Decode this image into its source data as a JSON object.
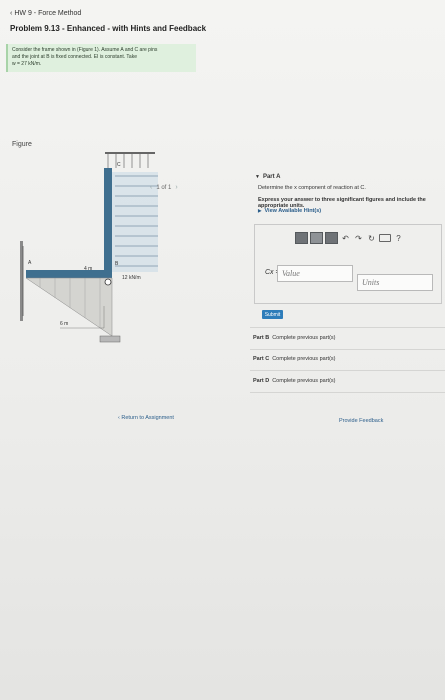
{
  "header": {
    "breadcrumb": "HW 9 - Force Method",
    "problem_title": "Problem 9.13 - Enhanced - with Hints and Feedback"
  },
  "intro": {
    "line1": "Consider the frame shown in (Figure 1). Assume A and C are pins",
    "line2": "and the joint at B is fixed connected. EI is constant. Take",
    "line3": "w = 27 kN/m."
  },
  "figure": {
    "label": "Figure",
    "pager_text": "1 of 1",
    "load_label": "12 kN/m",
    "dim_horizontal": "4 m",
    "dim_vertical": "6 m",
    "point_b": "B",
    "point_c": "C",
    "point_a": "A"
  },
  "part_a": {
    "title": "Part A",
    "instruction": "Determine the x component of reaction at C.",
    "express": "Express your answer to three significant figures and include the appropriate units.",
    "hints": "View Available Hint(s)",
    "answer_label": "Cx =",
    "value_placeholder": "Value",
    "units_placeholder": "Units",
    "submit_label": "Submit"
  },
  "parts": [
    {
      "name": "Part B",
      "status": "Complete previous part(s)"
    },
    {
      "name": "Part C",
      "status": "Complete previous part(s)"
    },
    {
      "name": "Part D",
      "status": "Complete previous part(s)"
    }
  ],
  "footer": {
    "return_label": "Return to Assignment",
    "feedback_label": "Provide Feedback"
  }
}
